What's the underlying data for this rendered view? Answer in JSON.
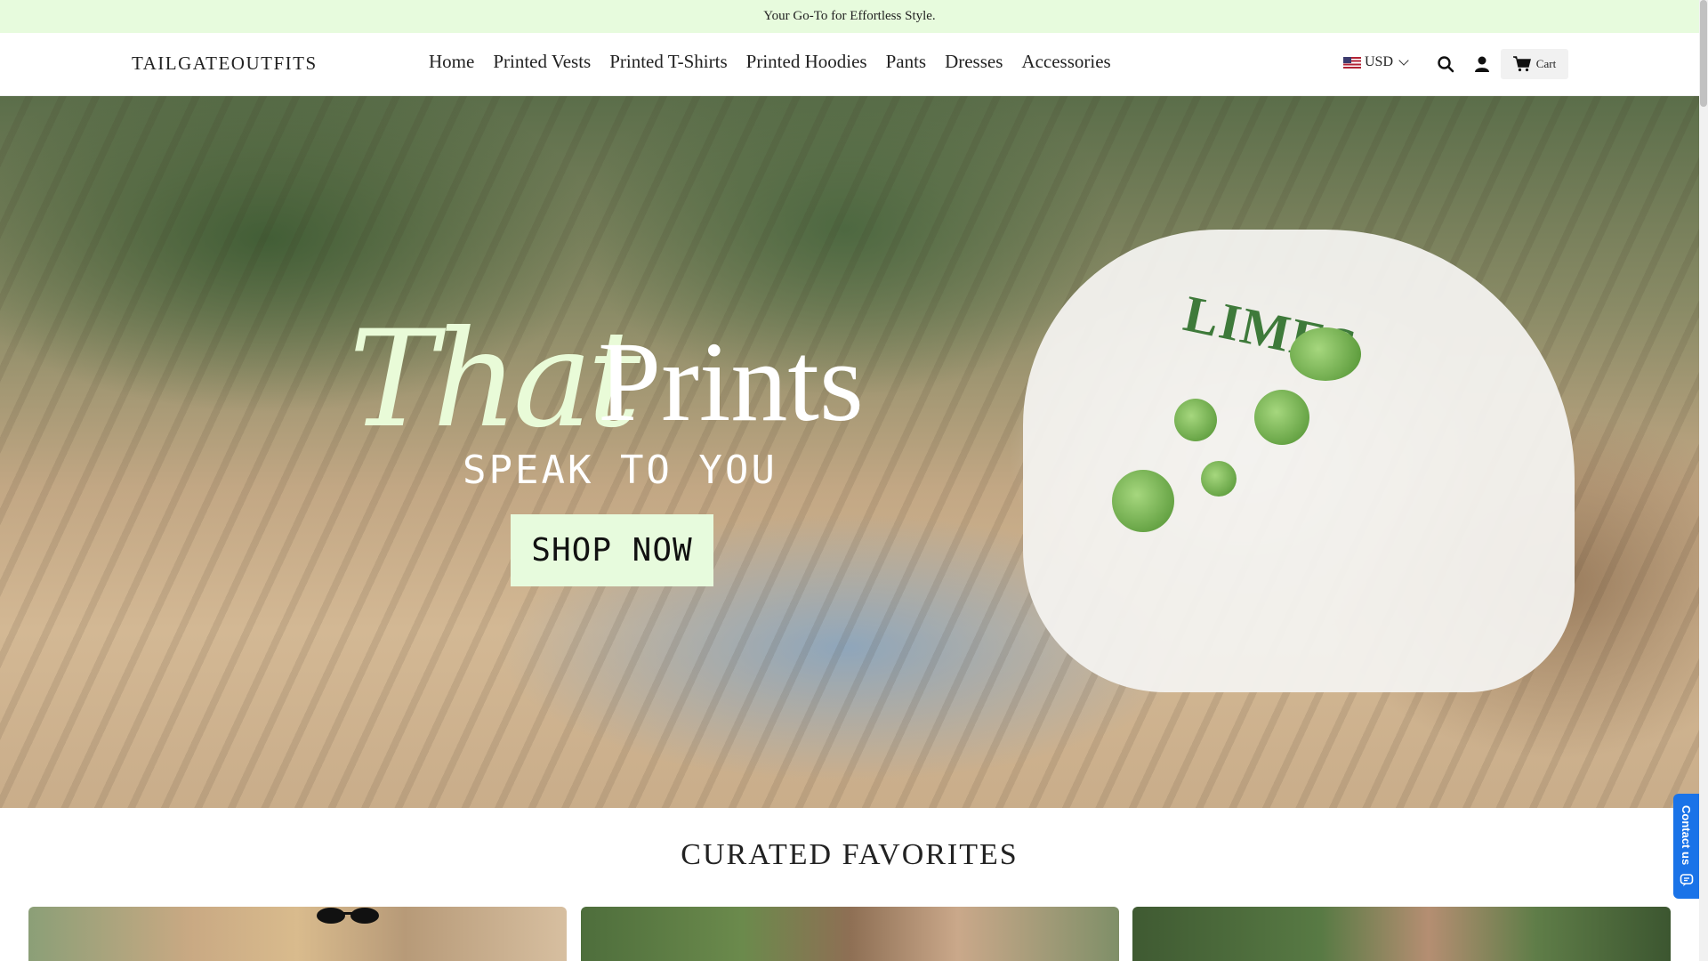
{
  "announcement": "Your Go-To for Effortless Style.",
  "header": {
    "logo": "TAILGATEOUTFITS",
    "nav": [
      "Home",
      "Printed Vests",
      "Printed T-Shirts",
      "Printed Hoodies",
      "Pants",
      "Dresses",
      "Accessories"
    ],
    "currency": "USD",
    "cart_label": "Cart",
    "icons": [
      "us-flag-icon",
      "chevron-down-icon",
      "search-icon",
      "account-icon",
      "cart-icon"
    ]
  },
  "hero": {
    "title_script": "That",
    "title_main": "Prints",
    "subtitle": "SPEAK TO YOU",
    "cta": "SHOP NOW",
    "shirt_print": "LIMES"
  },
  "curated": {
    "title": "CURATED FAVORITES"
  },
  "contact_tab": {
    "label": "Contact us",
    "icon": "chat-icon",
    "color": "#1a73e8"
  },
  "colors": {
    "accent": "#e7fbdd"
  }
}
